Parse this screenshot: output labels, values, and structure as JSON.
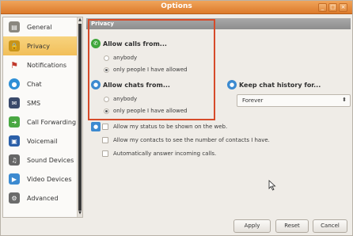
{
  "window": {
    "title": "Options"
  },
  "window_buttons": [
    "_",
    "□",
    "×"
  ],
  "sidebar": {
    "items": [
      {
        "label": "General",
        "icon": "general-icon",
        "color": "#7d7a74"
      },
      {
        "label": "Privacy",
        "icon": "privacy-lock-icon",
        "color": "#d9a21c",
        "active": true
      },
      {
        "label": "Notifications",
        "icon": "flag-icon",
        "color": "#c0392b"
      },
      {
        "label": "Chat",
        "icon": "chat-icon",
        "color": "#2f8fd6"
      },
      {
        "label": "SMS",
        "icon": "sms-icon",
        "color": "#3a4a6b"
      },
      {
        "label": "Call Forwarding",
        "icon": "call-forwarding-icon",
        "color": "#4aa843"
      },
      {
        "label": "Voicemail",
        "icon": "voicemail-icon",
        "color": "#2b5fa8"
      },
      {
        "label": "Sound Devices",
        "icon": "headset-icon",
        "color": "#555555"
      },
      {
        "label": "Video Devices",
        "icon": "video-device-icon",
        "color": "#3c8ad0"
      },
      {
        "label": "Advanced",
        "icon": "advanced-gear-icon",
        "color": "#6b6b6b"
      }
    ]
  },
  "content": {
    "section_title": "Privacy",
    "calls": {
      "title": "Allow calls from...",
      "options": [
        "anybody",
        "only people I have allowed"
      ],
      "selected_index": 1
    },
    "chats": {
      "title": "Allow chats from...",
      "options": [
        "anybody",
        "only people I have allowed"
      ],
      "selected_index": 1
    },
    "history": {
      "title": "Keep chat history for...",
      "value": "Forever"
    },
    "checkboxes": [
      {
        "label": "Allow my status to be shown on the web.",
        "checked": false
      },
      {
        "label": "Allow my contacts to see the number of contacts I have.",
        "checked": false
      },
      {
        "label": "Automatically answer incoming calls.",
        "checked": false
      }
    ]
  },
  "buttons": {
    "apply": "Apply",
    "reset": "Reset",
    "cancel": "Cancel"
  },
  "colors": {
    "accent": "#e08a3e",
    "highlight": "#d64b2a",
    "selected_sidebar": "#f2bf5a"
  }
}
